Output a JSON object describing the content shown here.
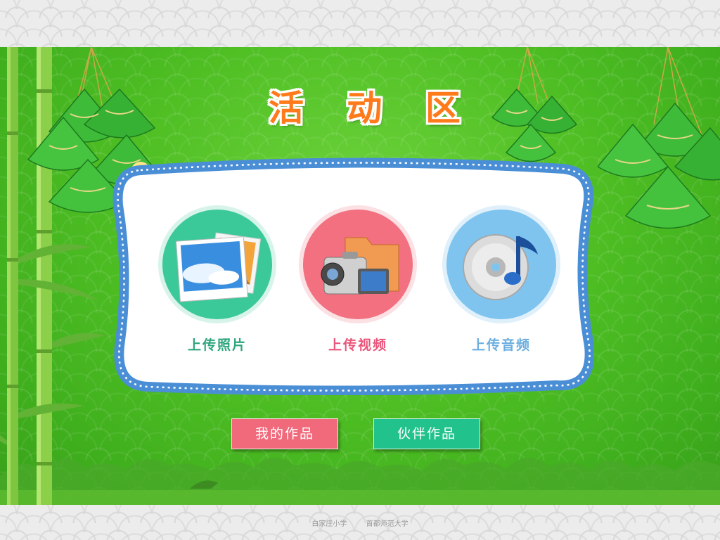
{
  "title": "活 动 区",
  "uploads": [
    {
      "label": "上传照片",
      "icon": "photo-icon",
      "color": "#3cc99a"
    },
    {
      "label": "上传视频",
      "icon": "video-camera-icon",
      "color": "#f2707f"
    },
    {
      "label": "上传音频",
      "icon": "music-cd-icon",
      "color": "#7ec4ef"
    }
  ],
  "buttons": {
    "my_works": "我的作品",
    "partner_works": "伙伴作品"
  },
  "footer": {
    "school": "白家庄小学",
    "university": "首都师范大学"
  },
  "colors": {
    "title": "#ff7a1a",
    "background_green": "#4fbf24",
    "card_border": "#4a8fd6",
    "my_works_button": "#f06a7c",
    "partner_works_button": "#22c28c"
  }
}
